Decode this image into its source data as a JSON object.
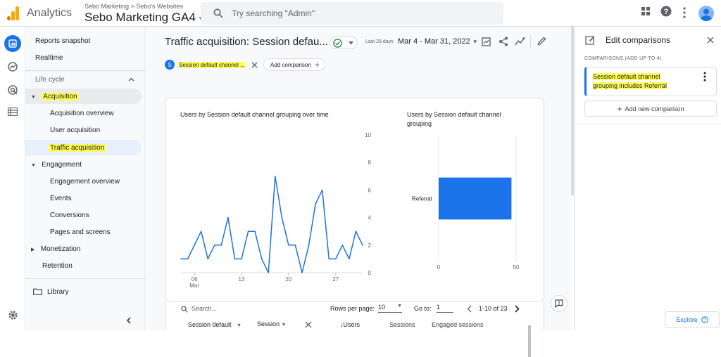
{
  "topbar": {
    "app_name": "Analytics",
    "breadcrumb": "Sebo Marketing > Sebo's Websites",
    "property_name": "Sebo Marketing GA4",
    "search_placeholder": "Try searching \"Admin\""
  },
  "nav": {
    "reports_snapshot": "Reports snapshot",
    "realtime": "Realtime",
    "lifecycle": "Life cycle",
    "acquisition": "Acquisition",
    "acquisition_overview": "Acquisition overview",
    "user_acquisition": "User acquisition",
    "traffic_acquisition": "Traffic acquisition",
    "engagement": "Engagement",
    "engagement_overview": "Engagement overview",
    "events": "Events",
    "conversions": "Conversions",
    "pages_and_screens": "Pages and screens",
    "monetization": "Monetization",
    "retention": "Retention",
    "library": "Library"
  },
  "main": {
    "title": "Traffic acquisition: Session defau...",
    "date_label": "Last 28 days",
    "date_range": "Mar 4 - Mar 31, 2022",
    "segment_initial": "S",
    "segment_chip": "Session default channel ...",
    "add_comparison": "Add comparison"
  },
  "chart_data": [
    {
      "type": "line",
      "title": "Users by Session default channel grouping over time",
      "x": [
        "Mar 4",
        "Mar 5",
        "Mar 6",
        "Mar 7",
        "Mar 8",
        "Mar 9",
        "Mar 10",
        "Mar 11",
        "Mar 12",
        "Mar 13",
        "Mar 14",
        "Mar 15",
        "Mar 16",
        "Mar 17",
        "Mar 18",
        "Mar 19",
        "Mar 20",
        "Mar 21",
        "Mar 22",
        "Mar 23",
        "Mar 24",
        "Mar 25",
        "Mar 26",
        "Mar 27",
        "Mar 28",
        "Mar 29",
        "Mar 30",
        "Mar 31"
      ],
      "values": [
        1,
        1,
        2,
        3,
        1,
        2,
        2,
        4,
        1,
        1,
        3,
        3,
        1,
        0,
        7,
        4,
        2,
        2,
        0,
        2,
        5,
        6,
        1,
        1,
        2,
        1,
        3,
        2
      ],
      "xticks": [
        "06",
        "13",
        "20",
        "27"
      ],
      "xtick_sub": "Mar",
      "ylim": [
        0,
        10
      ],
      "yticks": [
        0,
        2,
        4,
        6,
        8,
        10
      ],
      "color": "#1a73e8"
    },
    {
      "type": "bar",
      "title": "Users by Session default channel grouping",
      "categories": [
        "Referral"
      ],
      "values": [
        47
      ],
      "xlim": [
        0,
        50
      ],
      "xticks": [
        0,
        50
      ],
      "color": "#1a73e8"
    }
  ],
  "table": {
    "search_placeholder": "Search...",
    "rows_per_page_label": "Rows per page:",
    "rows_per_page": "10",
    "goto_label": "Go to:",
    "goto_value": "1",
    "range": "1-10 of 23",
    "col1": "Session default",
    "col2": "Session",
    "col_users": "↓Users",
    "col_sessions": "Sessions",
    "col_engaged": "Engaged sessions"
  },
  "side": {
    "title": "Edit comparisons",
    "subtitle": "COMPARISONS (ADD UP TO 4)",
    "comparison_line1": "Session default channel",
    "comparison_line2": "grouping includes Referral",
    "add_new": "Add new comparison",
    "explore": "Explore"
  },
  "colors": {
    "accent": "#1a73e8",
    "highlight": "#ffff55",
    "logo_orange": "#f9ab00",
    "logo_dark": "#e37400"
  }
}
